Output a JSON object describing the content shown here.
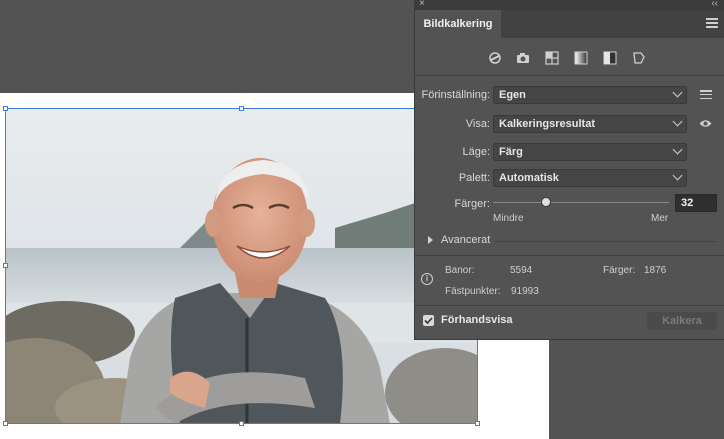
{
  "panel": {
    "tab_title": "Bildkalkering",
    "close_glyph": "×",
    "collapse_glyph": "‹‹",
    "preset_icons": [
      "auto-color-icon",
      "high-color-photo-icon",
      "low-color-icon",
      "grayscale-icon",
      "black-white-icon",
      "outline-icon"
    ],
    "preset_label": "Förinställning:",
    "preset_value": "Egen",
    "view_label": "Visa:",
    "view_value": "Kalkeringsresultat",
    "mode_label": "Läge:",
    "mode_value": "Färg",
    "palette_label": "Palett:",
    "palette_value": "Automatisk",
    "colors_label": "Färger:",
    "colors_value": "32",
    "colors_slider_fraction": 0.3,
    "slider_min_label": "Mindre",
    "slider_max_label": "Mer",
    "advanced_label": "Avancerat",
    "stats": {
      "paths_label": "Banor:",
      "paths_value": "5594",
      "colors_label": "Färger:",
      "colors_value": "1876",
      "anchors_label": "Fästpunkter:",
      "anchors_value": "91993"
    },
    "preview_label": "Förhandsvisa",
    "preview_checked": true,
    "trace_button": "Kalkera"
  },
  "colors": {
    "panel_bg": "#535353",
    "selection_blue": "#3d7fe0"
  }
}
